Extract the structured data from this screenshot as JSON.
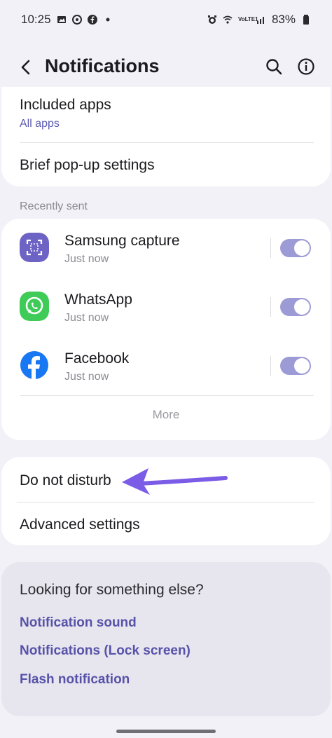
{
  "status_bar": {
    "time": "10:25",
    "battery": "83%",
    "icons_left": [
      "gallery-icon",
      "whatsapp-icon",
      "facebook-icon",
      "dot-icon"
    ],
    "icons_right": [
      "alarm-icon",
      "wifi-icon",
      "volte-icon",
      "signal-icon",
      "battery-icon"
    ],
    "volte_text": "VoLTE1"
  },
  "header": {
    "title": "Notifications"
  },
  "settings_top": {
    "included_apps_label": "Included apps",
    "included_apps_value": "All apps",
    "brief_popup_label": "Brief pop-up settings"
  },
  "recent": {
    "section_label": "Recently sent",
    "apps": [
      {
        "name": "Samsung capture",
        "time": "Just now",
        "enabled": true,
        "icon": "samsung-capture-icon"
      },
      {
        "name": "WhatsApp",
        "time": "Just now",
        "enabled": true,
        "icon": "whatsapp-app-icon"
      },
      {
        "name": "Facebook",
        "time": "Just now",
        "enabled": true,
        "icon": "facebook-app-icon"
      }
    ],
    "more_label": "More"
  },
  "settings_bottom": {
    "dnd_label": "Do not disturb",
    "advanced_label": "Advanced settings"
  },
  "looking": {
    "title": "Looking for something else?",
    "links": [
      "Notification sound",
      "Notifications (Lock screen)",
      "Flash notification"
    ]
  },
  "colors": {
    "accent": "#5752a8",
    "toggle_on": "#9d9bd6",
    "arrow": "#7b5ce6"
  }
}
